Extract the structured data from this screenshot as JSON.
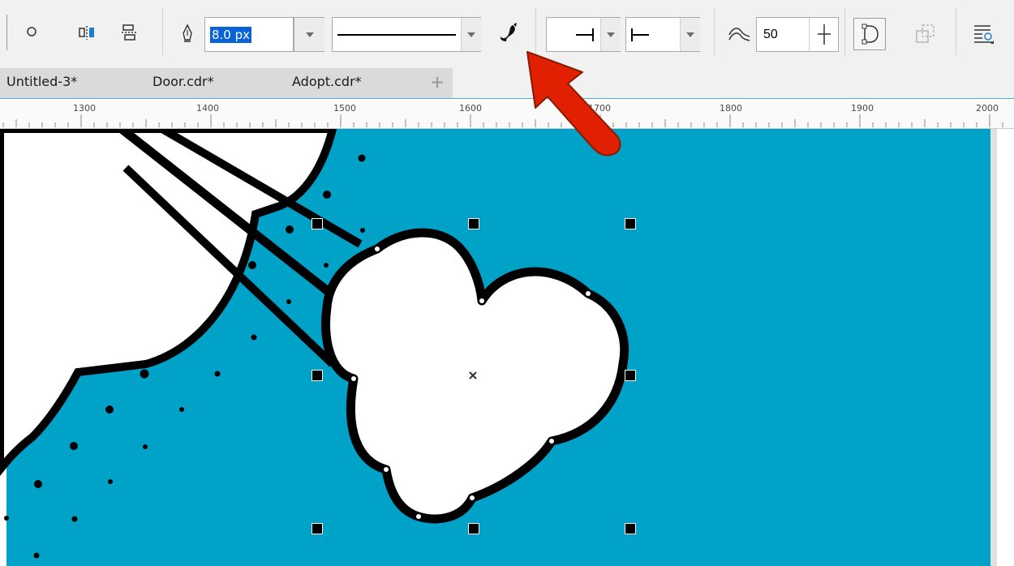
{
  "property_bar": {
    "outline_width": "8.0 px",
    "miter_value": "50",
    "icons": [
      "circle-icon",
      "align-icon",
      "distribute-icon",
      "pen-nib-icon",
      "calligraphy-brush-icon",
      "arrowhead-icon",
      "smooth-curve-icon",
      "close-curve-icon",
      "convert-to-object-icon",
      "wrap-text-icon"
    ]
  },
  "tabs": [
    {
      "label": "Untitled-3*"
    },
    {
      "label": "Door.cdr*"
    },
    {
      "label": "Adopt.cdr*"
    }
  ],
  "ruler": {
    "labels": [
      "1300",
      "1400",
      "1500",
      "1600",
      "1700",
      "1800",
      "1900",
      "2000"
    ]
  },
  "canvas": {
    "background_color": "#00a2c8",
    "stroke_color": "#000000",
    "annotation_arrow_color": "#e02000"
  }
}
